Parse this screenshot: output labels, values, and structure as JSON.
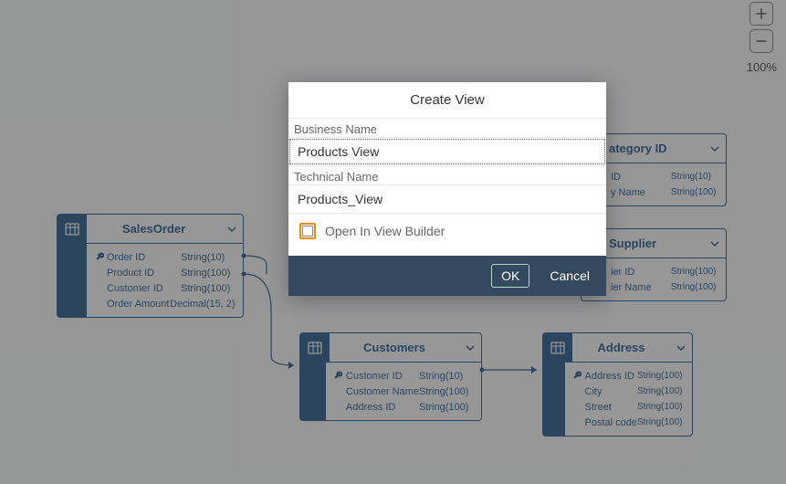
{
  "zoom": {
    "level": "100%"
  },
  "dialog": {
    "title": "Create View",
    "business_label": "Business Name",
    "business_value": "Products View",
    "technical_label": "Technical Name",
    "technical_value": "Products_View",
    "checkbox_label": "Open In View Builder",
    "checkbox_checked": false,
    "ok_label": "OK",
    "cancel_label": "Cancel"
  },
  "entities": {
    "sales_order": {
      "title": "SalesOrder",
      "cols": [
        {
          "key": true,
          "name": "Order ID",
          "type": "String(10)"
        },
        {
          "key": false,
          "name": "Product ID",
          "type": "String(100)"
        },
        {
          "key": false,
          "name": "Customer ID",
          "type": "String(100)"
        },
        {
          "key": false,
          "name": "Order Amount",
          "type": "Decimal(15, 2)"
        }
      ]
    },
    "customers": {
      "title": "Customers",
      "cols": [
        {
          "key": true,
          "name": "Customer ID",
          "type": "String(10)"
        },
        {
          "key": false,
          "name": "Customer Name",
          "type": "String(100)"
        },
        {
          "key": false,
          "name": "Address ID",
          "type": "String(100)"
        }
      ]
    },
    "category": {
      "title_suffix": "ategory ID",
      "cols": [
        {
          "key": false,
          "name_suffix": "ID",
          "type": "String(10)"
        },
        {
          "key": false,
          "name_suffix": "y Name",
          "type": "String(100)"
        }
      ]
    },
    "supplier": {
      "title": "Supplier",
      "cols": [
        {
          "key": false,
          "name_suffix": "ier ID",
          "type": "String(100)"
        },
        {
          "key": false,
          "name_suffix": "ier Name",
          "type": "String(100)"
        }
      ]
    },
    "address": {
      "title": "Address",
      "cols": [
        {
          "key": true,
          "name": "Address ID",
          "type": "String(100)"
        },
        {
          "key": false,
          "name": "City",
          "type": "String(100)"
        },
        {
          "key": false,
          "name": "Street",
          "type": "String(100)"
        },
        {
          "key": false,
          "name": "Postal code",
          "type": "String(100)"
        }
      ]
    }
  }
}
